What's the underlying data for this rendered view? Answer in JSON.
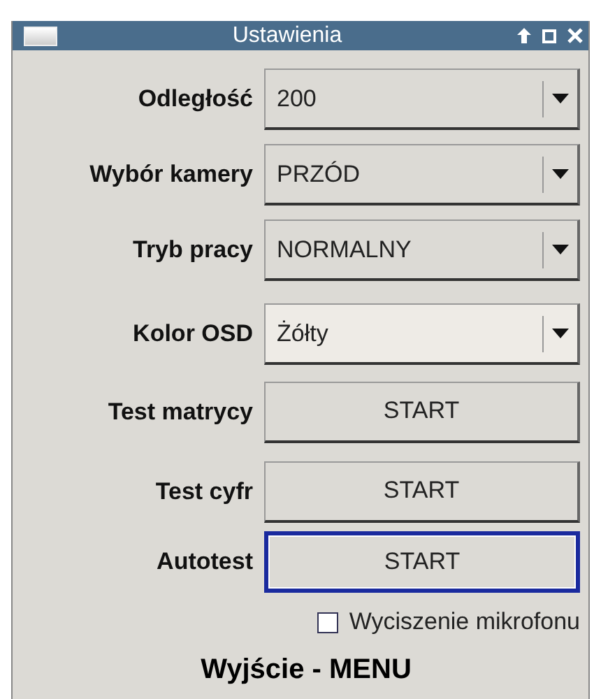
{
  "window": {
    "title": "Ustawienia"
  },
  "settings": [
    {
      "label": "Odległość",
      "kind": "dropdown",
      "value": "200",
      "hovered": false
    },
    {
      "label": "Wybór kamery",
      "kind": "dropdown",
      "value": "PRZÓD",
      "hovered": false
    },
    {
      "label": "Tryb pracy",
      "kind": "dropdown",
      "value": "NORMALNY",
      "hovered": false
    },
    {
      "label": "Kolor OSD",
      "kind": "dropdown",
      "value": "Żółty",
      "hovered": true
    },
    {
      "label": "Test matrycy",
      "kind": "button",
      "value": "START",
      "focused": false
    },
    {
      "label": "Test cyfr",
      "kind": "button",
      "value": "START",
      "focused": false
    },
    {
      "label": "Autotest",
      "kind": "button",
      "value": "START",
      "focused": true
    }
  ],
  "mute_checkbox": {
    "label": "Wyciszenie mikrofonu",
    "checked": false
  },
  "footer": "Wyjście - MENU"
}
